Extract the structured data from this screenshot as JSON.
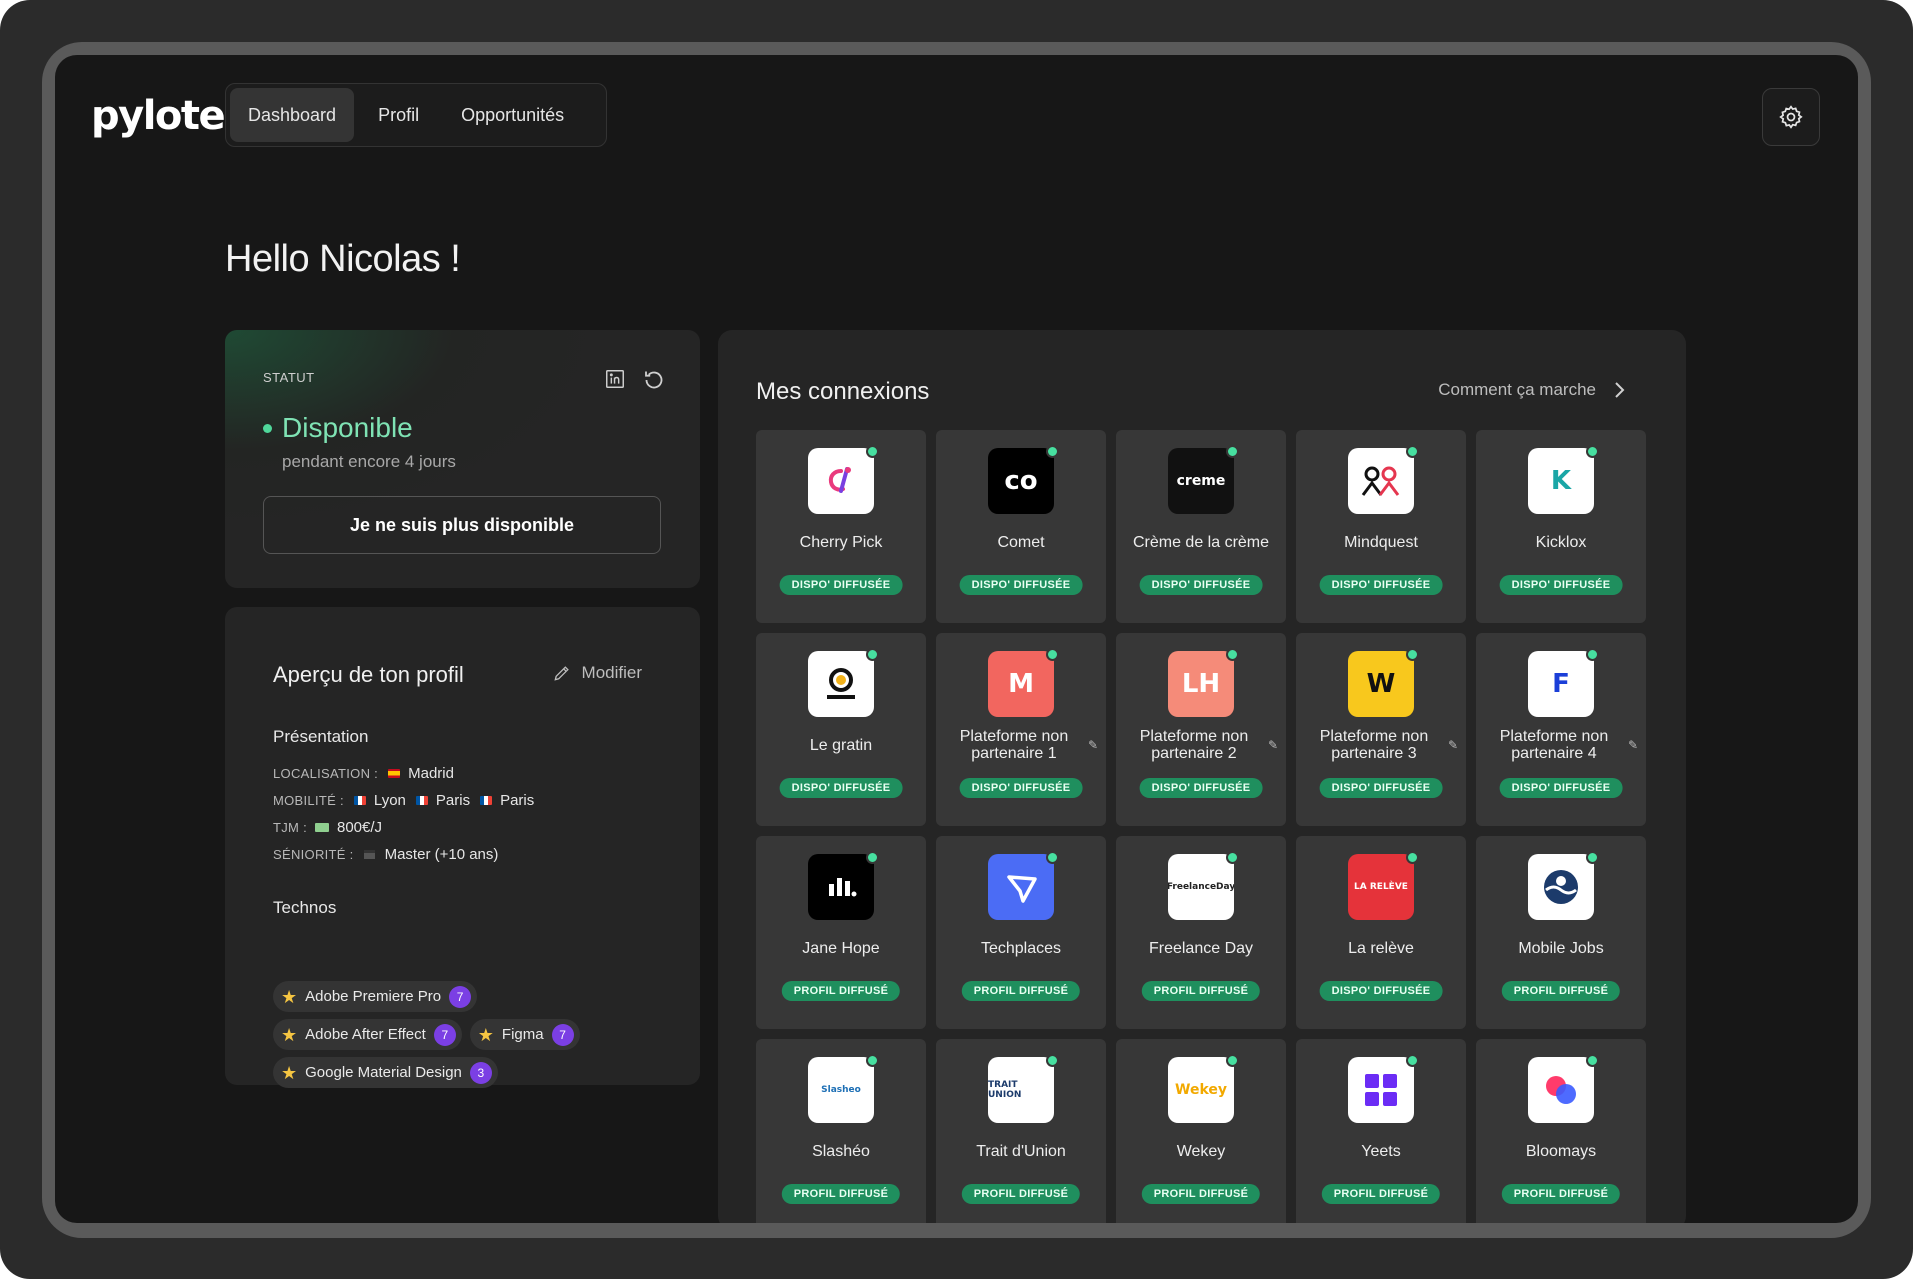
{
  "app": {
    "logo": "pylote"
  },
  "nav": {
    "tabs": [
      {
        "label": "Dashboard",
        "active": true
      },
      {
        "label": "Profil",
        "active": false
      },
      {
        "label": "Opportunités",
        "active": false
      }
    ]
  },
  "greeting": "Hello Nicolas !",
  "status": {
    "label": "STATUT",
    "value": "Disponible",
    "sub": "pendant encore 4 jours",
    "button": "Je ne suis plus disponible"
  },
  "profile": {
    "title": "Aperçu de ton profil",
    "modify": "Modifier",
    "presentation_heading": "Présentation",
    "localisation": {
      "key": "LOCALISATION :",
      "value": "Madrid"
    },
    "mobilite": {
      "key": "MOBILITÉ :",
      "values": [
        "Lyon",
        "Paris",
        "Paris"
      ]
    },
    "tjm": {
      "key": "TJM :",
      "value": "800€/J"
    },
    "seniorite": {
      "key": "SÉNIORITÉ :",
      "value": "Master (+10 ans)"
    },
    "technos_heading": "Technos",
    "technos": [
      {
        "name": "Adobe Premiere Pro",
        "count": "7"
      },
      {
        "name": "Adobe After Effect",
        "count": "7"
      },
      {
        "name": "Figma",
        "count": "7"
      },
      {
        "name": "Google Material Design",
        "count": "3"
      }
    ]
  },
  "connexions": {
    "title": "Mes connexions",
    "help_link": "Comment ça marche",
    "tiles": [
      {
        "name": "Cherry Pick",
        "badge": "DISPO' DIFFUSÉE",
        "logo_text": "",
        "logo_bg": "#ffffff",
        "logo_fg": "#e93a7d"
      },
      {
        "name": "Comet",
        "badge": "DISPO' DIFFUSÉE",
        "logo_text": "co",
        "logo_bg": "#000000",
        "logo_fg": "#ffffff"
      },
      {
        "name": "Crème de la crème",
        "badge": "DISPO' DIFFUSÉE",
        "logo_text": "creme",
        "logo_bg": "#111111",
        "logo_fg": "#ffffff"
      },
      {
        "name": "Mindquest",
        "badge": "DISPO' DIFFUSÉE",
        "logo_text": "",
        "logo_bg": "#ffffff",
        "logo_fg": "#e5364f"
      },
      {
        "name": "Kicklox",
        "badge": "DISPO' DIFFUSÉE",
        "logo_text": "K",
        "logo_bg": "#ffffff",
        "logo_fg": "#1aa6a6"
      },
      {
        "name": "Le gratin",
        "badge": "DISPO' DIFFUSÉE",
        "logo_text": "",
        "logo_bg": "#ffffff",
        "logo_fg": "#111111"
      },
      {
        "name": "Plateforme non partenaire 1",
        "badge": "DISPO' DIFFUSÉE",
        "logo_text": "M",
        "logo_bg": "#f2665f",
        "logo_fg": "#ffffff",
        "editable": true
      },
      {
        "name": "Plateforme non partenaire 2",
        "badge": "DISPO' DIFFUSÉE",
        "logo_text": "LH",
        "logo_bg": "#f58b79",
        "logo_fg": "#ffffff",
        "editable": true
      },
      {
        "name": "Plateforme non partenaire 3",
        "badge": "DISPO' DIFFUSÉE",
        "logo_text": "W",
        "logo_bg": "#f8c81d",
        "logo_fg": "#111111",
        "editable": true
      },
      {
        "name": "Plateforme non partenaire 4",
        "badge": "DISPO' DIFFUSÉE",
        "logo_text": "F",
        "logo_bg": "#ffffff",
        "logo_fg": "#1b3fd8",
        "editable": true
      },
      {
        "name": "Jane Hope",
        "badge": "PROFIL DIFFUSÉ",
        "logo_text": "",
        "logo_bg": "#000000",
        "logo_fg": "#ffffff"
      },
      {
        "name": "Techplaces",
        "badge": "PROFIL DIFFUSÉ",
        "logo_text": "",
        "logo_bg": "#4b6cf5",
        "logo_fg": "#ffffff"
      },
      {
        "name": "Freelance Day",
        "badge": "PROFIL DIFFUSÉ",
        "logo_text": "FreelanceDay",
        "logo_bg": "#ffffff",
        "logo_fg": "#222222"
      },
      {
        "name": "La relève",
        "badge": "DISPO' DIFFUSÉE",
        "logo_text": "LA RELÈVE",
        "logo_bg": "#e5333a",
        "logo_fg": "#ffffff"
      },
      {
        "name": "Mobile Jobs",
        "badge": "PROFIL DIFFUSÉ",
        "logo_text": "",
        "logo_bg": "#ffffff",
        "logo_fg": "#1c3b6b"
      },
      {
        "name": "Slashéo",
        "badge": "PROFIL DIFFUSÉ",
        "logo_text": "Slasheo",
        "logo_bg": "#ffffff",
        "logo_fg": "#1d6fb5"
      },
      {
        "name": "Trait d'Union",
        "badge": "PROFIL DIFFUSÉ",
        "logo_text": "TRAIT UNION",
        "logo_bg": "#ffffff",
        "logo_fg": "#1c3b6b"
      },
      {
        "name": "Wekey",
        "badge": "PROFIL DIFFUSÉ",
        "logo_text": "Wekey",
        "logo_bg": "#ffffff",
        "logo_fg": "#f2a900"
      },
      {
        "name": "Yeets",
        "badge": "PROFIL DIFFUSÉ",
        "logo_text": "",
        "logo_bg": "#ffffff",
        "logo_fg": "#6b2cf5"
      },
      {
        "name": "Bloomays",
        "badge": "PROFIL DIFFUSÉ",
        "logo_text": "",
        "logo_bg": "#ffffff",
        "logo_fg": "#ff3b6b"
      }
    ]
  }
}
